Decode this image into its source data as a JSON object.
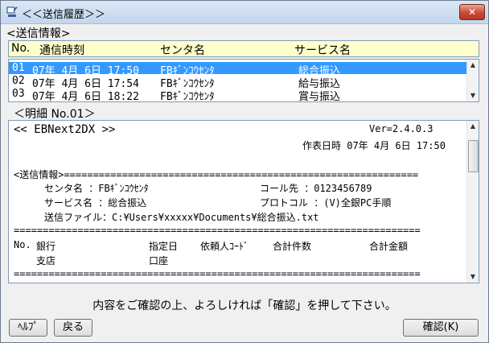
{
  "window": {
    "title": "＜＜送信履歴＞＞"
  },
  "send_info": {
    "label": "<送信情報>",
    "headers": {
      "no": "No.",
      "datetime": "通信時刻",
      "center": "センタ名",
      "service": "サービス名"
    },
    "rows": [
      {
        "no": "01",
        "datetime": "07年 4月 6日 17:50",
        "center": "FBｷﾞﾝｺｳｾﾝﾀ",
        "service": "総合振込",
        "selected": true
      },
      {
        "no": "02",
        "datetime": "07年 4月 6日 17:54",
        "center": "FBｷﾞﾝｺｳｾﾝﾀ",
        "service": "給与振込",
        "selected": false
      },
      {
        "no": "03",
        "datetime": "07年 4月 6日 18:22",
        "center": "FBｷﾞﾝｺｳｾﾝﾀ",
        "service": "賞与振込",
        "selected": false
      }
    ]
  },
  "detail": {
    "label": "＜明細 No.01＞",
    "title": "<<  EBNext2DX  >>",
    "version": "Ver=2.4.0.3",
    "created": "作表日時  07年 4月 6日 17:50",
    "section_header": "<送信情報>=============================================================",
    "center_line": "センタ名  ：FBｷﾞﾝｺｳｾﾝﾀ",
    "call_line": "コール先    ：0123456789",
    "service_line": "サービス名 ：総合振込",
    "protocol_line": "プロトコル  ：(V)全銀PC手順",
    "file_line": "送信ファイル：C:¥Users¥xxxxx¥Documents¥総合振込.txt",
    "separator": "======================================================================",
    "col_no": "No.",
    "col_bank": "銀行",
    "col_branch": "支店",
    "col_date": "指定日",
    "col_account": "口座",
    "col_requester": "依頼人ｺｰﾄﾞ",
    "col_count": "合計件数",
    "col_amount": "合計金額"
  },
  "message": "内容をご確認の上、よろしければ「確認」を押して下さい。",
  "buttons": {
    "help": "ﾍﾙﾌﾟ",
    "back": "戻る",
    "confirm": "確認(K)"
  }
}
